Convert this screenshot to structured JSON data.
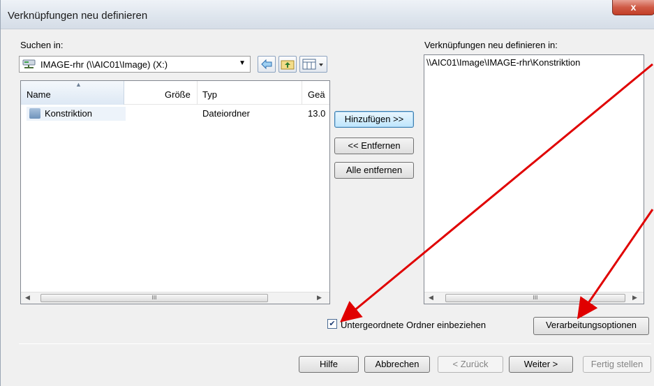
{
  "window": {
    "title": "Verknüpfungen neu definieren",
    "close_label": "x"
  },
  "source": {
    "search_in_label": "Suchen in:",
    "location_value": "IMAGE-rhr (\\\\AIC01\\Image) (X:)",
    "columns": [
      "Name",
      "Größe",
      "Typ",
      "Geä"
    ],
    "rows": [
      {
        "name": "Konstriktion",
        "size": "",
        "type": "Dateiordner",
        "modified": "13.0"
      }
    ]
  },
  "actions": {
    "add": "Hinzufügen >>",
    "remove": "<< Entfernen",
    "remove_all": "Alle entfernen"
  },
  "target": {
    "label": "Verknüpfungen neu definieren in:",
    "paths": [
      "\\\\AIC01\\Image\\IMAGE-rhr\\Konstriktion"
    ]
  },
  "options": {
    "include_subfolders_label": "Untergeordnete Ordner einbeziehen",
    "include_subfolders_checked": true,
    "processing_options": "Verarbeitungsoptionen"
  },
  "footer": {
    "help": "Hilfe",
    "cancel": "Abbrechen",
    "back": "< Zurück",
    "next": "Weiter >",
    "finish": "Fertig stellen"
  },
  "scrollbar_grip": "III",
  "colors": {
    "annotation_arrow": "#e00000",
    "close_button": "#c9462f"
  }
}
